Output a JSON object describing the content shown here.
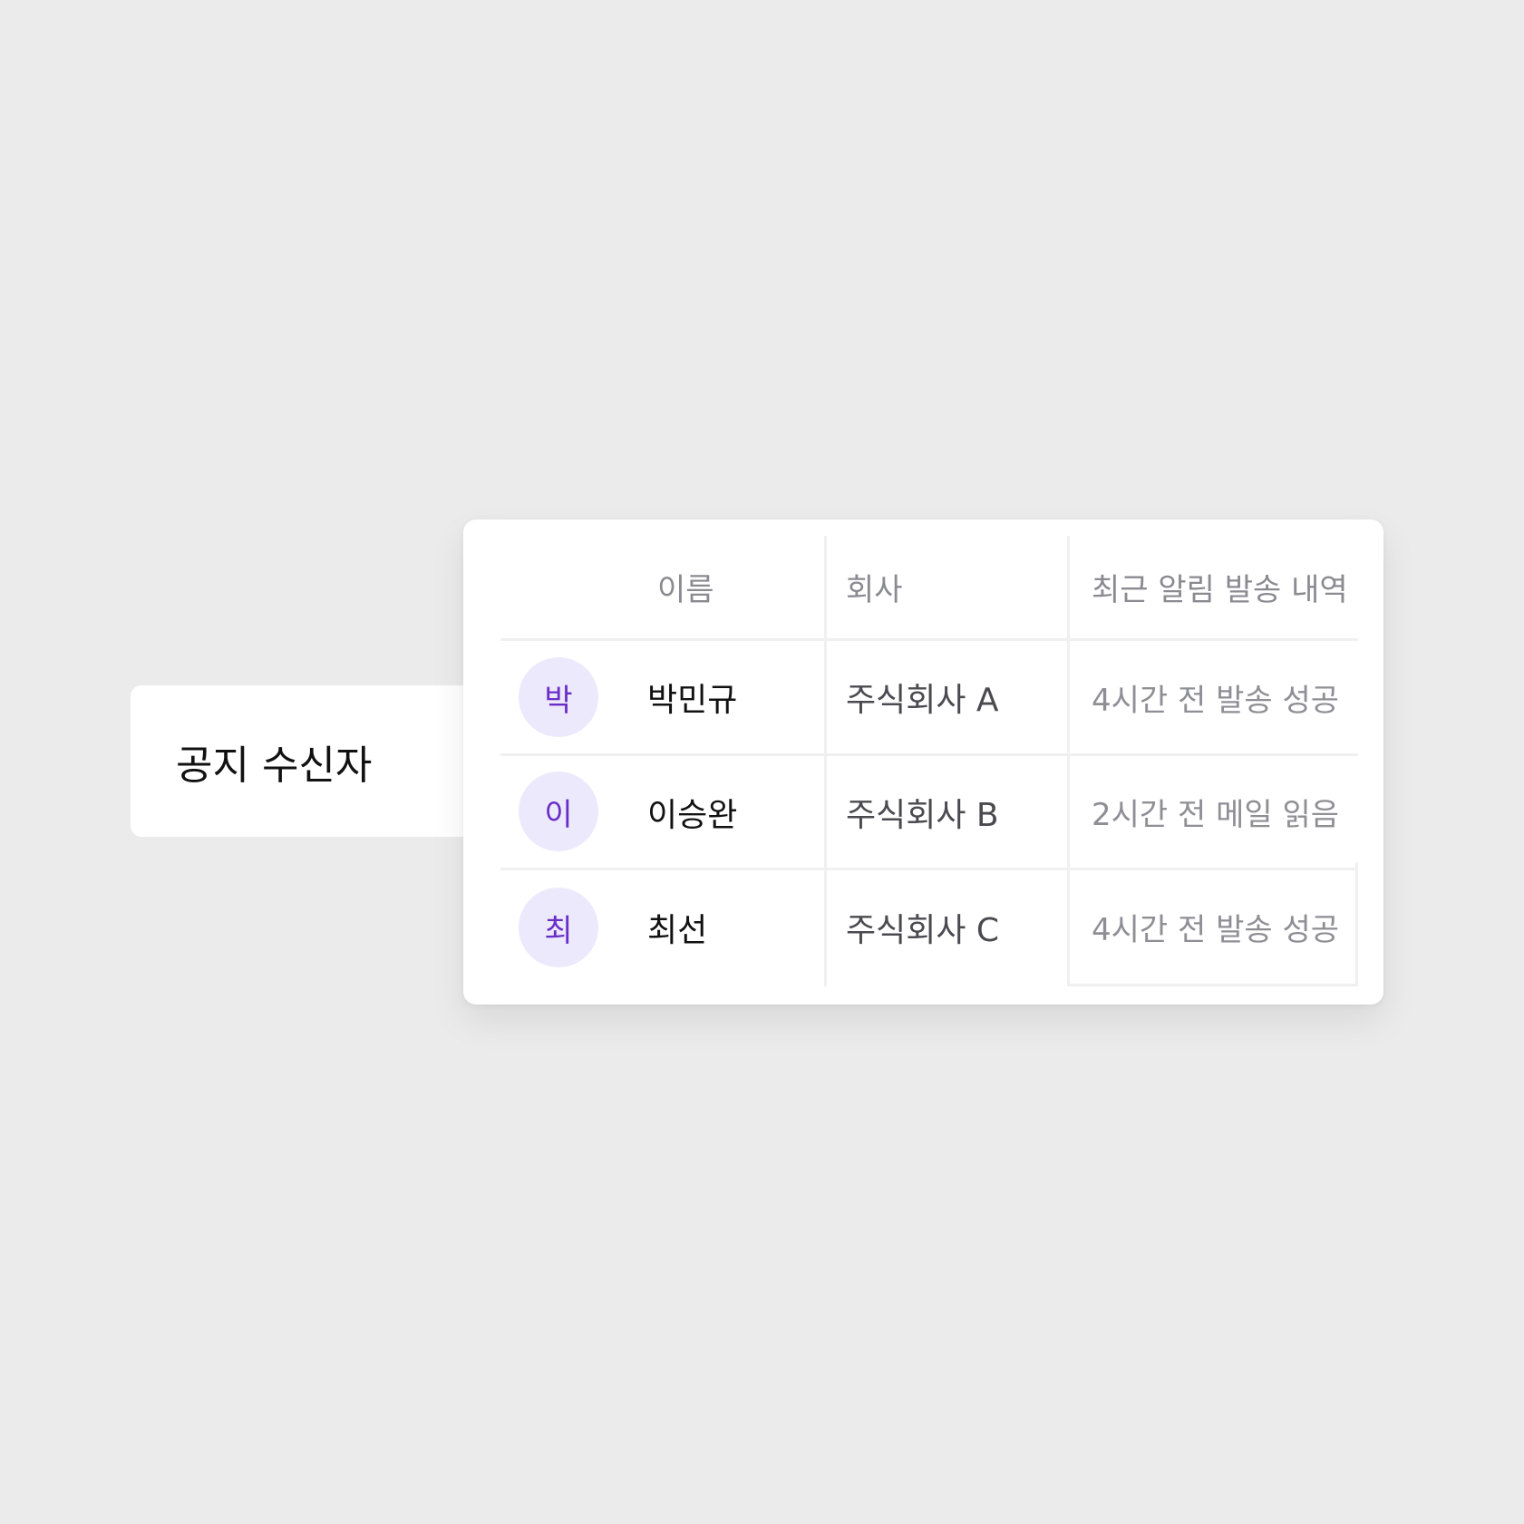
{
  "label": {
    "title": "공지 수신자"
  },
  "table": {
    "columns": [
      "이름",
      "회사",
      "최근 알림 발송 내역"
    ],
    "rows": [
      {
        "avatar": "박",
        "name": "박민규",
        "company": "주식회사 A",
        "history": "4시간 전 발송 성공"
      },
      {
        "avatar": "이",
        "name": "이승완",
        "company": "주식회사 B",
        "history": "2시간 전 메일 읽음"
      },
      {
        "avatar": "최",
        "name": "최선",
        "company": "주식회사 C",
        "history": "4시간 전 발송 성공"
      }
    ]
  },
  "colors": {
    "background": "#ebebeb",
    "card": "#ffffff",
    "avatar_bg": "#ede9fc",
    "avatar_fg": "#6a2ec8",
    "header_text": "#8a8a91",
    "divider": "#f0f0f1"
  }
}
